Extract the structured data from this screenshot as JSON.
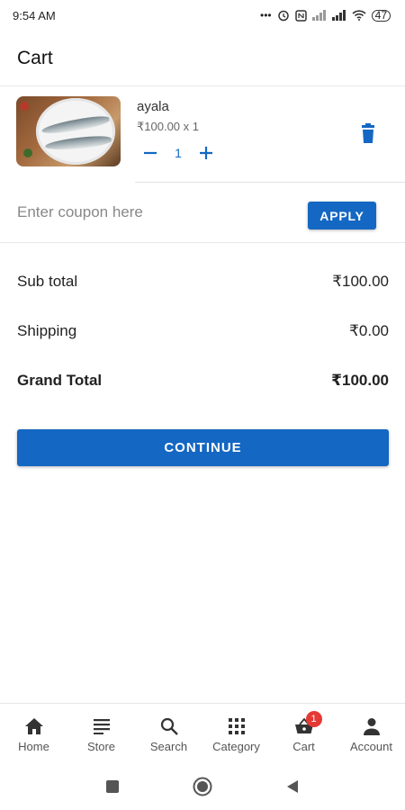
{
  "status_bar": {
    "time": "9:54 AM",
    "battery": "47",
    "icons": [
      "dots-icon",
      "alarm-icon",
      "nfc-icon",
      "signal-icon",
      "signal-icon",
      "wifi-icon",
      "battery-icon"
    ]
  },
  "app_bar": {
    "title": "Cart"
  },
  "cart": {
    "items": [
      {
        "name": "ayala",
        "price_line": "₹100.00 x 1",
        "quantity": "1",
        "image": "fish-on-plate-image"
      }
    ]
  },
  "coupon": {
    "placeholder": "Enter coupon here",
    "value": "",
    "apply_label": "APPLY"
  },
  "summary": {
    "subtotal_label": "Sub total",
    "subtotal_value": "₹100.00",
    "shipping_label": "Shipping",
    "shipping_value": "₹0.00",
    "grand_label": "Grand Total",
    "grand_value": "₹100.00"
  },
  "continue_label": "CONTINUE",
  "bottom_nav": {
    "items": [
      {
        "label": "Home",
        "icon": "home-icon"
      },
      {
        "label": "Store",
        "icon": "store-icon"
      },
      {
        "label": "Search",
        "icon": "search-icon"
      },
      {
        "label": "Category",
        "icon": "category-grid-icon"
      },
      {
        "label": "Cart",
        "icon": "cart-basket-icon",
        "badge": "1"
      },
      {
        "label": "Account",
        "icon": "account-icon"
      }
    ]
  },
  "colors": {
    "accent": "#1467c2",
    "badge": "#e53935"
  }
}
